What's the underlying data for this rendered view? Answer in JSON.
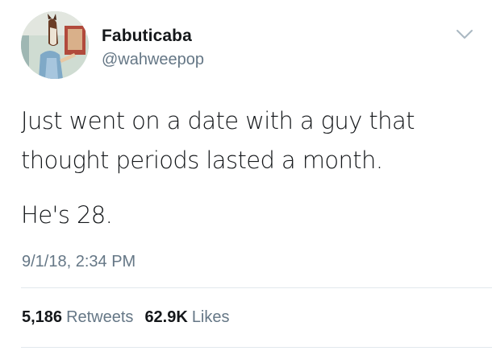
{
  "user": {
    "display_name": "Fabuticaba",
    "handle": "@wahweepop"
  },
  "icons": {
    "avatar": "avatar-image",
    "menu": "chevron-down-icon"
  },
  "tweet": {
    "lines": [
      "Just went on a date with a guy that",
      "thought periods lasted a month.",
      "He's 28."
    ],
    "timestamp": "9/1/18, 2:34 PM"
  },
  "stats": {
    "retweets_count": "5,186",
    "retweets_label": "Retweets",
    "likes_count": "62.9K",
    "likes_label": "Likes"
  },
  "colors": {
    "primary_text": "#14171a",
    "secondary_text": "#657786",
    "divider": "#e1e8ed"
  }
}
